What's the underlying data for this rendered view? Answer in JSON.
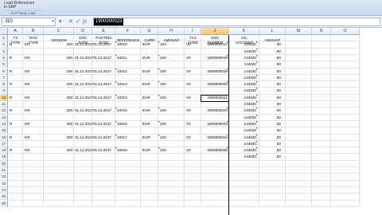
{
  "ribbon": {
    "group_line1": "Load    References",
    "group_line2": "in SAP",
    "group_label": "SAP Data Load"
  },
  "formula_bar": {
    "name_box": "J10",
    "name_arrow": "▾",
    "icon_menu": "▾",
    "icon_cancel": "✕",
    "icon_enter": "✓",
    "icon_fx": "fx",
    "value": "1900000023"
  },
  "columns": [
    "A",
    "B",
    "C",
    "D",
    "E",
    "F",
    "G",
    "H",
    "I",
    "J",
    "K",
    "L",
    "M"
  ],
  "extra_columns": [
    "N",
    "O"
  ],
  "selected_column": "J",
  "selected_row": "10",
  "headers": {
    "a1": "TX",
    "a2": "TYPE",
    "b1": "DOC",
    "b2": "TYPE",
    "c": "VENDOR",
    "d1": "DOC",
    "d2": "DATE",
    "e1": "POSTING",
    "e2": "DATE",
    "f": "REFERENCE",
    "g": "CURR",
    "h": "AMOUNT",
    "i1": "TAX",
    "i2": "CODE",
    "j1": "DOC",
    "j2": "NUMBER",
    "k1": "G/L",
    "k2": "ACCOUNT",
    "l": "AMOUNT"
  },
  "rows": [
    {
      "n": "1",
      "type": "header"
    },
    {
      "n": "2",
      "type": "data",
      "a": "R",
      "b": "KR",
      "c": "200",
      "d": "01.12.2017",
      "e": "01.12.2017",
      "f": "10010",
      "g": "EUR",
      "h": "100",
      "i": "V0",
      "j": "1900000017",
      "k": "144020",
      "l": "50"
    },
    {
      "n": "3",
      "type": "sub",
      "k": "144020",
      "l": "50"
    },
    {
      "n": "4",
      "type": "data",
      "a": "R",
      "b": "KR",
      "c": "200",
      "d": "01.12.2017",
      "e": "01.12.2017",
      "f": "10011",
      "g": "EUR",
      "h": "100",
      "i": "V0",
      "j": "1900000018",
      "k": "144020",
      "l": "50"
    },
    {
      "n": "5",
      "type": "sub",
      "k": "144020",
      "l": "50"
    },
    {
      "n": "6",
      "type": "data",
      "a": "R",
      "b": "KR",
      "c": "200",
      "d": "01.12.2017",
      "e": "01.12.2017",
      "f": "10012",
      "g": "EUR",
      "h": "100",
      "i": "V0",
      "j": "1900000019",
      "k": "144020",
      "l": "50"
    },
    {
      "n": "7",
      "type": "sub",
      "k": "144020",
      "l": "50"
    },
    {
      "n": "8",
      "type": "data",
      "a": "R",
      "b": "KR",
      "c": "200",
      "d": "01.12.2017",
      "e": "01.12.2017",
      "f": "10013",
      "g": "EUR",
      "h": "100",
      "i": "V0",
      "j": "1900000020",
      "k": "144020",
      "l": "50"
    },
    {
      "n": "9",
      "type": "sub",
      "k": "144020",
      "l": "50"
    },
    {
      "n": "10",
      "type": "data",
      "a": "R",
      "b": "KR",
      "c": "200",
      "d": "01.12.2017",
      "e": "01.12.2017",
      "f": "10014",
      "g": "EUR",
      "h": "100",
      "i": "V0",
      "j": "1900000021",
      "k": "144020",
      "l": "50",
      "active": true
    },
    {
      "n": "11",
      "type": "sub",
      "k": "144020",
      "l": "50"
    },
    {
      "n": "12",
      "type": "data",
      "a": "R",
      "b": "KR",
      "c": "200",
      "d": "01.12.2017",
      "e": "01.12.2017",
      "f": "10015",
      "g": "EUR",
      "h": "100",
      "i": "V0",
      "j": "1900000022",
      "k": "144020",
      "l": "50"
    },
    {
      "n": "13",
      "type": "sub",
      "k": "144020",
      "l": "50"
    },
    {
      "n": "14",
      "type": "data",
      "a": "R",
      "b": "KR",
      "c": "200",
      "d": "01.12.2017",
      "e": "01.12.2017",
      "f": "10016",
      "g": "EUR",
      "h": "100",
      "i": "V0",
      "j": "1900000023",
      "k": "144020",
      "l": "50"
    },
    {
      "n": "15",
      "type": "sub",
      "k": "144020",
      "l": "50"
    },
    {
      "n": "16",
      "type": "data",
      "a": "R",
      "b": "KR",
      "c": "200",
      "d": "01.12.2017",
      "e": "01.12.2017",
      "f": "10017",
      "g": "EUR",
      "h": "100",
      "i": "V0",
      "j": "1900000024",
      "k": "144020",
      "l": "50"
    },
    {
      "n": "17",
      "type": "sub",
      "k": "144020",
      "l": "50"
    },
    {
      "n": "18",
      "type": "data",
      "a": "R",
      "b": "KR",
      "c": "200",
      "d": "01.12.2017",
      "e": "01.12.2017",
      "f": "10018",
      "g": "EUR",
      "h": "100",
      "i": "V0",
      "j": "1900000025",
      "k": "144020",
      "l": "50"
    },
    {
      "n": "19",
      "type": "sub",
      "k": "144020",
      "l": "50"
    },
    {
      "n": "20",
      "type": "empty"
    },
    {
      "n": "21",
      "type": "empty"
    },
    {
      "n": "22",
      "type": "empty"
    },
    {
      "n": "23",
      "type": "empty"
    },
    {
      "n": "24",
      "type": "empty"
    },
    {
      "n": "25",
      "type": "empty"
    },
    {
      "n": "26",
      "type": "empty"
    }
  ],
  "colors": {
    "accent": "#f3c56a",
    "marker": "#2a8a2a",
    "ribbon": "#dfe9f5"
  }
}
